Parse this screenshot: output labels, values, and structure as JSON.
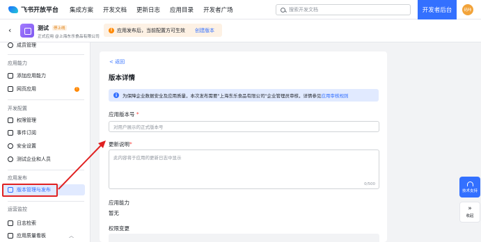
{
  "topnav": {
    "logo_text": "飞书开放平台",
    "links": [
      "集成方案",
      "开发文档",
      "更新日志",
      "应用目录",
      "开发者广场"
    ],
    "search_placeholder": "搜索开发文档",
    "dev_console": "开发者后台",
    "avatar_text": "码咔"
  },
  "app": {
    "name": "测试",
    "status_tag": "停上线",
    "subtitle": "正式应用 @上海东乐食品有限公司",
    "banner_text": "应用发布后，当前配置方可生效",
    "banner_link": "创建版本"
  },
  "sidebar": {
    "item_member": "成员管理",
    "section_capability": "应用能力",
    "item_add_capability": "添加应用能力",
    "item_web_app": "网页应用",
    "web_app_badge": "!",
    "section_dev_config": "开发配置",
    "item_permission": "权限管理",
    "item_event": "事件订阅",
    "item_security": "安全设置",
    "item_test_enterprise": "测试企业和人员",
    "section_release": "应用发布",
    "item_version": "版本管理与发布",
    "section_ops": "运营监控",
    "item_log": "日志检索",
    "item_quality": "应用质量看板"
  },
  "main": {
    "back_label": "< 返回",
    "title": "版本详情",
    "info_text": "为保障企业数据安全及应用质量，本次发布需要\"上海东乐食品有限公司\"企业管理员审核，详情参见",
    "info_link": "应用审核规则",
    "version_label": "应用版本号",
    "version_placeholder": "对用户展示的正式版本号",
    "notes_label": "更新说明",
    "notes_placeholder": "此内容将于应用的更新日志中显示",
    "notes_counter": "0/500",
    "capability_label": "应用能力",
    "capability_value": "暂无",
    "permission_change_label": "权限变更",
    "required_mark": "*"
  },
  "float": {
    "support_label": "技术支持",
    "collapse_label": "收起"
  },
  "colors": {
    "accent": "#3370ff",
    "highlight": "#e02020",
    "warning": "#ff8800"
  }
}
